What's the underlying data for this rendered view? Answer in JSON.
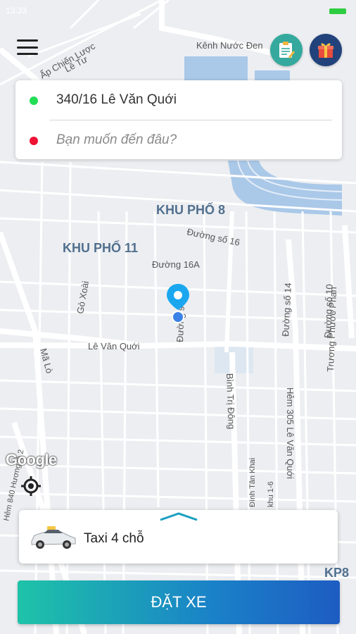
{
  "status_bar": {
    "time": "13:33"
  },
  "map": {
    "labels": {
      "kenh": "Kênh Nước Đen",
      "ap_chien_luoc": "Ấp Chiến Lược",
      "le_tu": "Lê Tư",
      "khu_pho_8": "KHU PHỐ 8",
      "khu_pho_11": "KHU PHỐ 11",
      "duong_so_16": "Đường số 16",
      "duong_16a": "Đường 16A",
      "go_xoai": "Gò Xoài",
      "le_van_quoi": "Lê Văn Quới",
      "duong_so_8": "Đường số 8",
      "duong_so_14": "Đường số 14",
      "duong_so_10": "Đường số 10",
      "ma_lo": "Mã Lò",
      "binh_tri_dong": "Bình Trị Đông",
      "hem_305": "Hẻm 305 Lê Văn Quới",
      "truong_phuoc_phan": "Trương Phước Phan",
      "dinh_tan_khai": "Đình Tân Khai",
      "khu_1_6": "khu 1-6",
      "hem_840": "Hẻm 840 Hương lộ 2"
    },
    "google_logo": "Google",
    "corner_label": "KP8"
  },
  "header": {
    "menu_icon": "hamburger-menu-icon",
    "orders_icon": "clipboard-icon",
    "gift_icon": "gift-icon"
  },
  "address": {
    "pickup": "340/16 Lê Văn Quới",
    "destination_placeholder": "Bạn muốn đến đâu?",
    "pickup_color": "#22dd55",
    "destination_color": "#ee1133"
  },
  "vehicle": {
    "name": "Taxi 4 chỗ"
  },
  "action": {
    "book_label": "ĐẶT XE"
  },
  "colors": {
    "accent_start": "#1ec3a8",
    "accent_end": "#1d5cc2",
    "marker": "#1aa7f0",
    "water": "#aac8e8"
  }
}
